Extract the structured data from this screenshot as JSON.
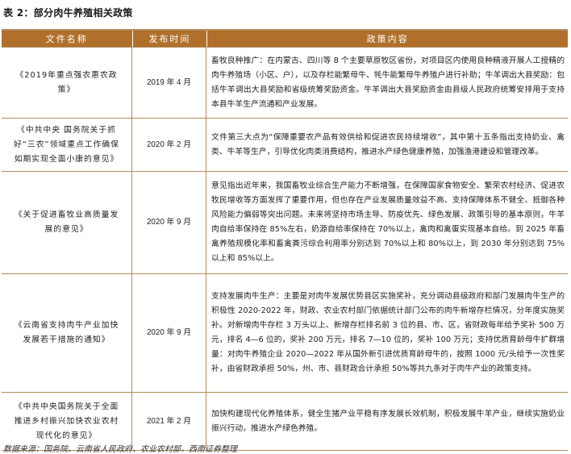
{
  "title": "表 2：部分肉牛养殖相关政策",
  "table": {
    "headers": [
      "文件名称",
      "发布时间",
      "政策内容"
    ],
    "rows": [
      {
        "name": "《2019年重点强农惠农政策》",
        "date": "2019 年 4 月",
        "content": "畜牧良种推广：在内蒙古、四川等 8 个主要草原牧区省份，对项目区内使用良种精液开展人工授精的肉牛养殖场（小区、户），以及存栏能繁母牛、牦牛能繁母牛养殖户进行补助；牛羊调出大县奖励：包括牛羊调出大县奖励和省级统筹奖励资金。牛羊调出大县奖励资金由县级人民政府统筹安排用于支持本县牛羊生产流通和产业发展。"
      },
      {
        "name": "《中共中央 国务院关于抓好“三农”领域重点工作确保如期实现全面小康的意见》",
        "date": "2020 年 2 月",
        "content": "文件第三大点为“保障重要农产品有效供给和促进农民持续增收”，其中第十五条指出支持奶业、禽类、牛羊等生产，引导优化肉类消费结构，推进水产绿色健康养殖，加强渔港建设和管理改革。"
      },
      {
        "name": "《关于促进畜牧业高质量发展的意见》",
        "date": "2020 年 9 月",
        "content": "意见指出近年来，我国畜牧业综合生产能力不断增强，在保障国家食物安全、繁荣农村经济、促进农牧民增收等方面发挥了重要作用，但也存在产业发展质量效益不高、支持保障体系不健全、抵御各种风险能力偏弱等突出问题。未来将坚持市场主导、防疫优先、绿色发展、政策引导的基本原则，牛羊肉自给率保持在 85%左右，奶源自给率保持在 70%以上，禽肉和禽蛋实现基本自给。到 2025 年畜禽养殖规模化率和畜禽粪污综合利用率分别达到 70%以上和 80%以上，到 2030 年分别达到 75%以上和 85%以上。"
      },
      {
        "name": "《云南省支持肉牛产业加快发展若干措施的通知》",
        "date": "2020 年 9 月",
        "content": "支持发展肉牛生产：主要是对肉牛发展优势县区实施奖补，充分调动县级政府和部门发展肉牛生产的积极性 2020-2022 年，财政、农业农村部门依据统计部门公布的肉牛新增存栏情况，分年度实施奖补。对新增肉牛存栏 3 万头以上、新增存栏排名前 3 位的县、市、区，省财政每年给予奖补 500 万元，排名 4—6 位的，奖补 200 万元，排名 7—10 位的，奖补 100 万元；支持优质育龄母牛扩群增量：对肉牛养殖企业 2020—2022 年从国外新引进优质育龄母牛的，按照 1000 元/头给予一次性奖补，由省财政承担 50%，州、市、县财政合计承担 50%等共九条对于肉牛产业的政策支持。"
      },
      {
        "name": "《中共中央国务院关于全面推进乡村振兴加快农业农村现代化的意见》",
        "date": "2021 年 2 月",
        "content": "加快构建现代化养殖体系，健全生猪产业平稳有序发展长效机制，积极发展牛羊产业，继续实施奶业振兴行动，推进水产绿色养殖。"
      }
    ]
  },
  "source": "数据来源：国务院、云南省人民政府、农业农村部，西南证券整理"
}
